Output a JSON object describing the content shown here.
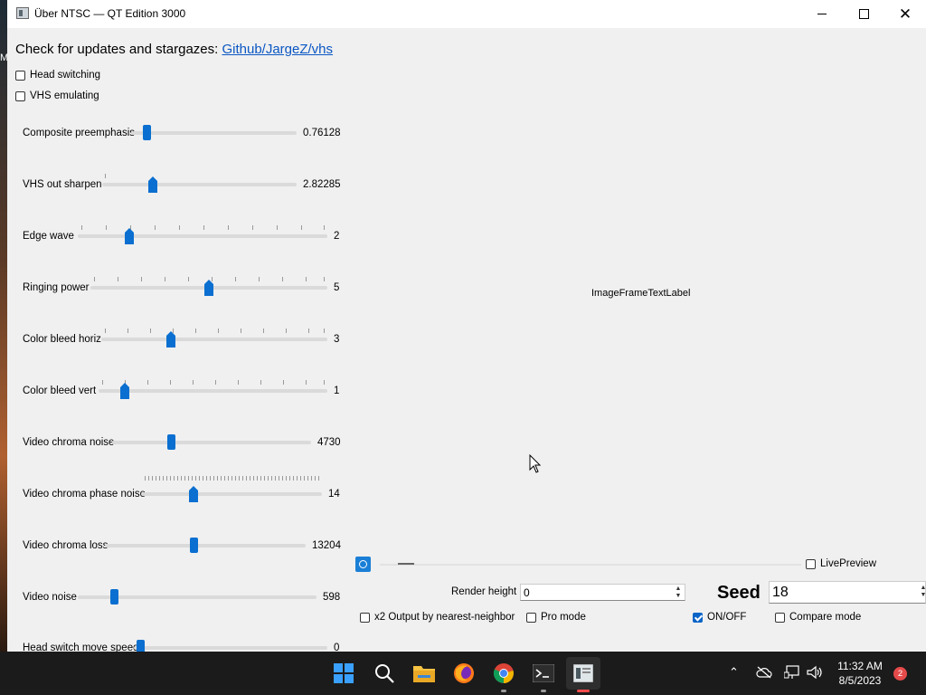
{
  "desktop": {
    "edge_text": "M"
  },
  "window": {
    "title": "Über NTSC — QT Edition 3000"
  },
  "header": {
    "text": "Check for updates and stargazes: ",
    "link_text": "Github/JargeZ/vhs"
  },
  "checkboxes_top": [
    {
      "label": "Head switching",
      "checked": false
    },
    {
      "label": "VHS emulating",
      "checked": false
    }
  ],
  "params": [
    {
      "label": "Composite preemphasis",
      "value": "0.76128"
    },
    {
      "label": "VHS out sharpen",
      "value": "2.82285"
    },
    {
      "label": "Edge wave",
      "value": "2"
    },
    {
      "label": "Ringing power",
      "value": "5"
    },
    {
      "label": "Color bleed horiz",
      "value": "3"
    },
    {
      "label": "Color bleed vert",
      "value": "1"
    },
    {
      "label": "Video chroma noise",
      "value": "4730"
    },
    {
      "label": "Video chroma phase noise",
      "value": "14"
    },
    {
      "label": "Video chroma loss",
      "value": "13204"
    },
    {
      "label": "Video noise",
      "value": "598"
    },
    {
      "label": "Head switch move speed",
      "value": "0"
    }
  ],
  "preview": {
    "image_label": "ImageFrameTextLabel"
  },
  "controls": {
    "live_preview": {
      "label": "LivePreview",
      "checked": false
    },
    "render_height": {
      "label": "Render height",
      "value": "0"
    },
    "seed": {
      "label": "Seed",
      "value": "18"
    },
    "x2_output": {
      "label": "x2 Output by nearest-neighbor",
      "checked": false
    },
    "pro_mode": {
      "label": "Pro mode",
      "checked": false
    },
    "on_off": {
      "label": "ON/OFF",
      "checked": true
    },
    "compare_mode": {
      "label": "Compare mode",
      "checked": false
    }
  },
  "taskbar": {
    "apps": [
      "start-icon",
      "search-icon",
      "file-explorer-icon",
      "firefox-icon",
      "chrome-icon",
      "terminal-icon",
      "ntsc-app-icon"
    ],
    "clock_time": "11:32 AM",
    "clock_date": "8/5/2023",
    "notifications": "2"
  }
}
